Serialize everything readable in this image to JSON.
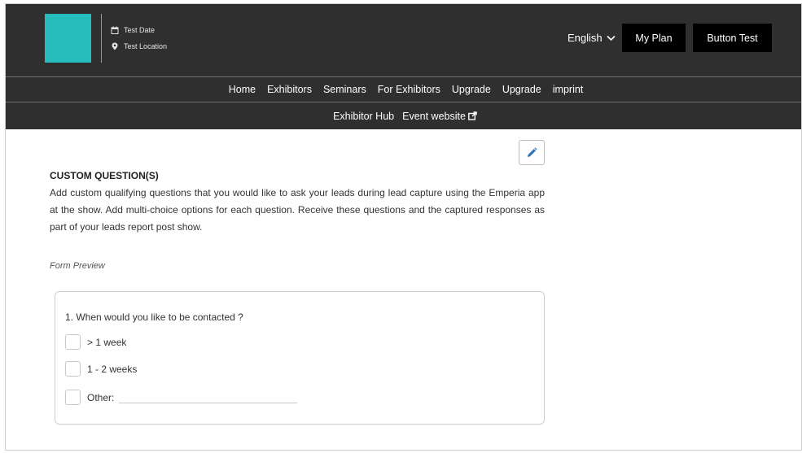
{
  "header": {
    "event_date": "Test Date",
    "event_location": "Test Location",
    "language": "English",
    "my_plan_label": "My Plan",
    "button_test_label": "Button Test",
    "logo_color": "#27bdbd"
  },
  "nav": {
    "primary": [
      "Home",
      "Exhibitors",
      "Seminars",
      "For Exhibitors",
      "Upgrade",
      "Upgrade",
      "imprint"
    ],
    "secondary": [
      "Exhibitor Hub",
      "Event website"
    ]
  },
  "icons": {
    "calendar": "calendar-icon",
    "location": "location-pin-icon",
    "language_dropdown": "chevron-down-icon",
    "external": "external-link-icon",
    "edit": "pencil-icon"
  },
  "content": {
    "section_title": "CUSTOM QUESTION(S)",
    "description": "Add custom qualifying questions that you would like to ask your leads during lead capture using the Emperia app at the show. Add multi-choice options for each question. Receive these questions and the captured responses as part of your leads report post show.",
    "preview_label": "Form Preview",
    "question": "1. When would you like to be contacted ?",
    "options": [
      "> 1 week",
      "1 - 2 weeks",
      "Other:"
    ]
  },
  "colors": {
    "header_bg": "#2f2f2f",
    "button_bg": "#000000",
    "edit_icon": "#2a73b8"
  }
}
